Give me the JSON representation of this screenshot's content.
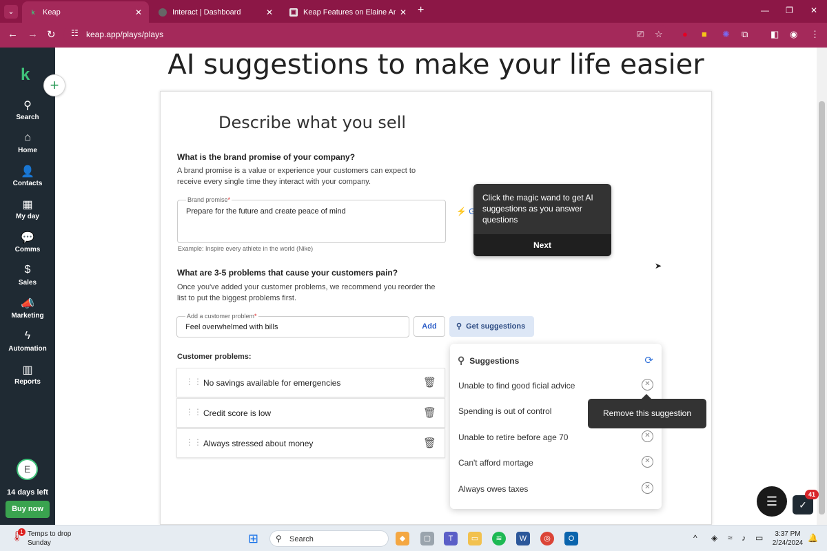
{
  "browser": {
    "tabs": [
      {
        "title": "Keap",
        "active": true
      },
      {
        "title": "Interact | Dashboard",
        "active": false
      },
      {
        "title": "Keap Features on Elaine And Fr",
        "active": false
      }
    ],
    "url": "keap.app/plays/plays"
  },
  "sidebar": {
    "items": [
      {
        "label": "Search",
        "icon": "search-icon"
      },
      {
        "label": "Home",
        "icon": "home-icon"
      },
      {
        "label": "Contacts",
        "icon": "contacts-icon"
      },
      {
        "label": "My day",
        "icon": "calendar-icon"
      },
      {
        "label": "Comms",
        "icon": "chat-icon"
      },
      {
        "label": "Sales",
        "icon": "sales-icon"
      },
      {
        "label": "Marketing",
        "icon": "megaphone-icon"
      },
      {
        "label": "Automation",
        "icon": "lightning-icon"
      },
      {
        "label": "Reports",
        "icon": "bar-chart-icon"
      }
    ],
    "avatar_initial": "E",
    "trial_text": "14 days left",
    "buy_label": "Buy now"
  },
  "main": {
    "heading": "AI suggestions to make your life easier",
    "card_title": "Describe what you sell",
    "brand_question": "What is the brand promise of your company?",
    "brand_description": "A brand promise is a value or experience your customers can expect to receive every single time they interact with your company.",
    "brand_field_label": "Brand promise",
    "brand_field_value": "Prepare for the future and create peace of mind",
    "brand_example": "Example: Inspire every athlete in the world (Nike)",
    "problems_question": "What are 3-5 problems that cause your customers pain?",
    "problems_description": "Once you've added your customer problems, we recommend you reorder the list to put the biggest problems first.",
    "problem_field_label": "Add a customer problem",
    "problem_field_value": "Feel overwhelmed with bills",
    "add_label": "Add",
    "get_suggestions_label": "Get suggestions",
    "customer_problems_label": "Customer problems:",
    "customer_problems": [
      "No savings available for emergencies",
      "Credit score is low",
      "Always stressed about money"
    ]
  },
  "tooltip": {
    "text": "Click the magic wand to get AI suggestions as you answer questions",
    "next_label": "Next"
  },
  "suggestions": {
    "title": "Suggestions",
    "items": [
      "Unable to find good ficial advice",
      "Spending is out of control",
      "Unable to retire before age 70",
      "Can't afford mortage",
      "Always owes taxes"
    ],
    "remove_tooltip": "Remove this suggestion"
  },
  "widgets": {
    "badge_count": "41"
  },
  "taskbar": {
    "weather_title": "Temps to drop",
    "weather_sub": "Sunday",
    "weather_badge": "1",
    "search_placeholder": "Search",
    "time": "3:37 PM",
    "date": "2/24/2024"
  },
  "colors": {
    "browser_frame": "#8c1746",
    "sidebar": "#1f2a33",
    "brand_green": "#3fc27a",
    "accent_blue": "#2e6fd8"
  }
}
